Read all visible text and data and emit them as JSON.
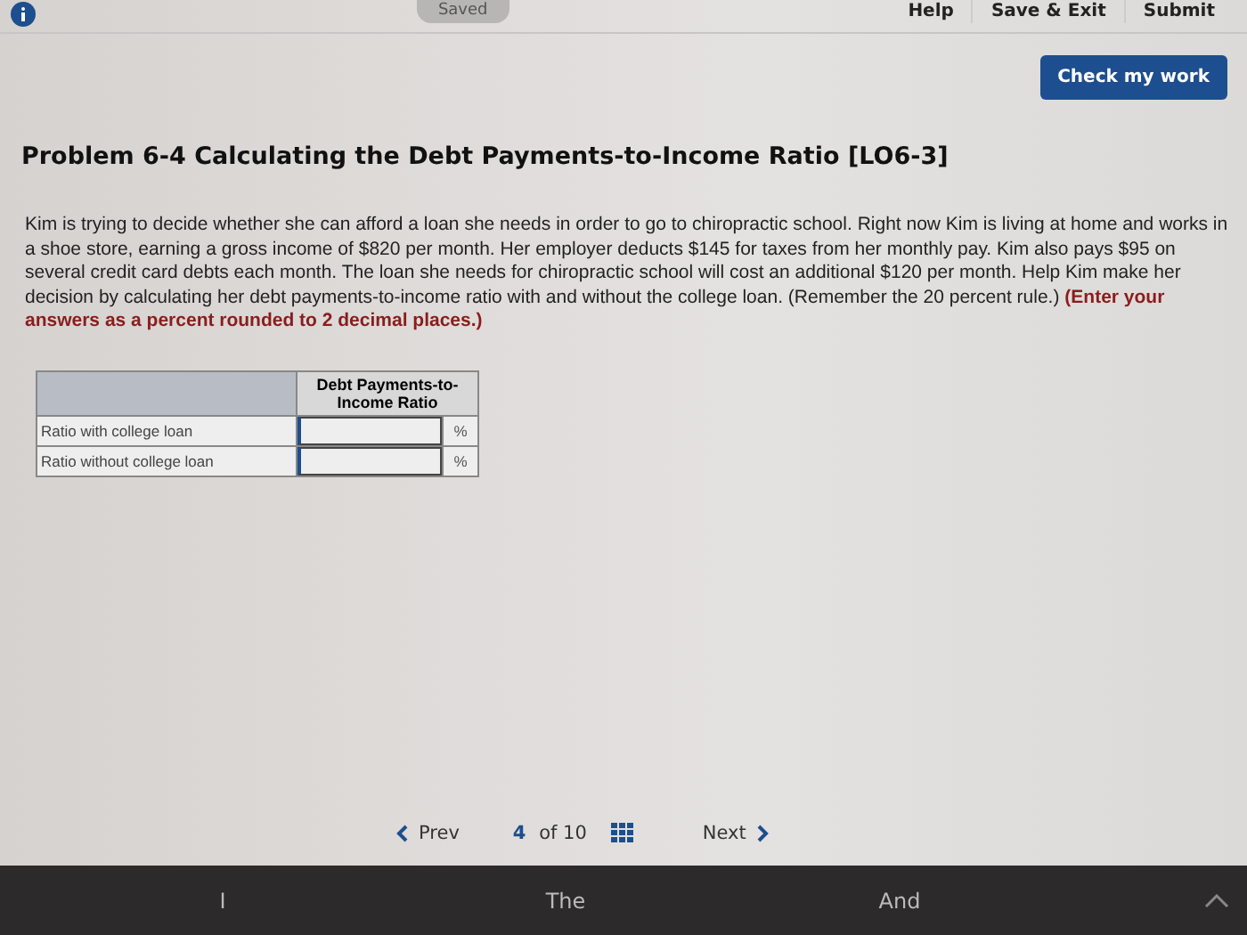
{
  "top_bar": {
    "status": "Saved",
    "links": [
      "Help",
      "Save & Exit",
      "Submit"
    ]
  },
  "check_button": "Check my work",
  "problem": {
    "title": "Problem 6-4 Calculating the Debt Payments-to-Income Ratio [LO6-3]",
    "body": "Kim is trying to decide whether she can afford a loan she needs in order to go to chiropractic school. Right now Kim is living at home and works in a shoe store, earning a gross income of $820 per month. Her employer deducts $145 for taxes from her monthly pay. Kim also pays $95 on several credit card debts each month. The loan she needs for chiropractic school will cost an additional $120 per month. Help Kim make her decision by calculating her debt payments-to-income ratio with and without the college loan. (Remember the 20 percent rule.) **(Enter your answers as a percent rounded to 2 decimal places.)**"
  },
  "table": {
    "column_header": "Debt Payments-to-Income Ratio",
    "rows": [
      {
        "label": "Ratio with college loan",
        "unit": "%"
      },
      {
        "label": "Ratio without college loan",
        "unit": "%"
      }
    ]
  },
  "pager": {
    "prev": "Prev",
    "current": "4",
    "of": "of",
    "total": "10",
    "next": "Next"
  },
  "suggestions": [
    "I",
    "The",
    "And"
  ]
}
